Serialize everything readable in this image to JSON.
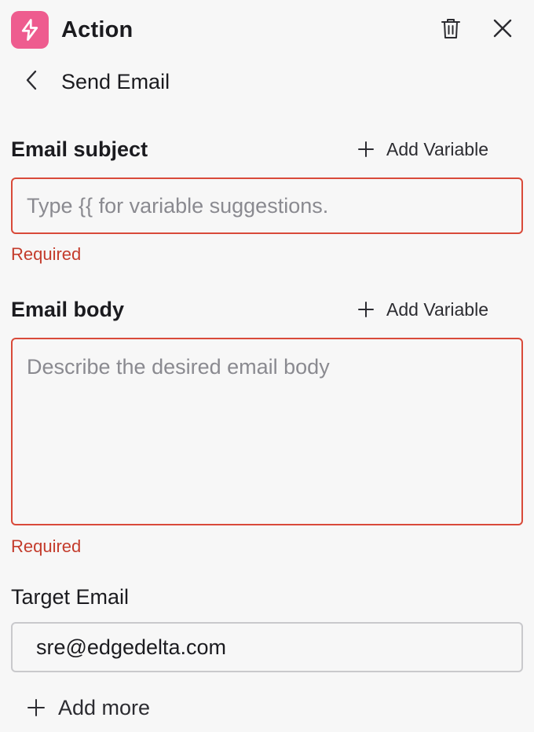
{
  "header": {
    "title": "Action",
    "app_icon": "lightning-bolt-icon",
    "accent_color": "#ee5c8f"
  },
  "subheader": {
    "title": "Send Email"
  },
  "fields": {
    "subject": {
      "label": "Email subject",
      "add_variable": "Add Variable",
      "placeholder": "Type {{ for variable suggestions.",
      "error": "Required"
    },
    "body": {
      "label": "Email body",
      "add_variable": "Add Variable",
      "placeholder": "Describe the desired email body",
      "error": "Required"
    },
    "target": {
      "label": "Target Email",
      "value": "sre@edgedelta.com"
    }
  },
  "add_more": "Add more",
  "colors": {
    "error": "#c43c2c",
    "error_border": "#d94a3a",
    "background": "#f7f7f7"
  }
}
